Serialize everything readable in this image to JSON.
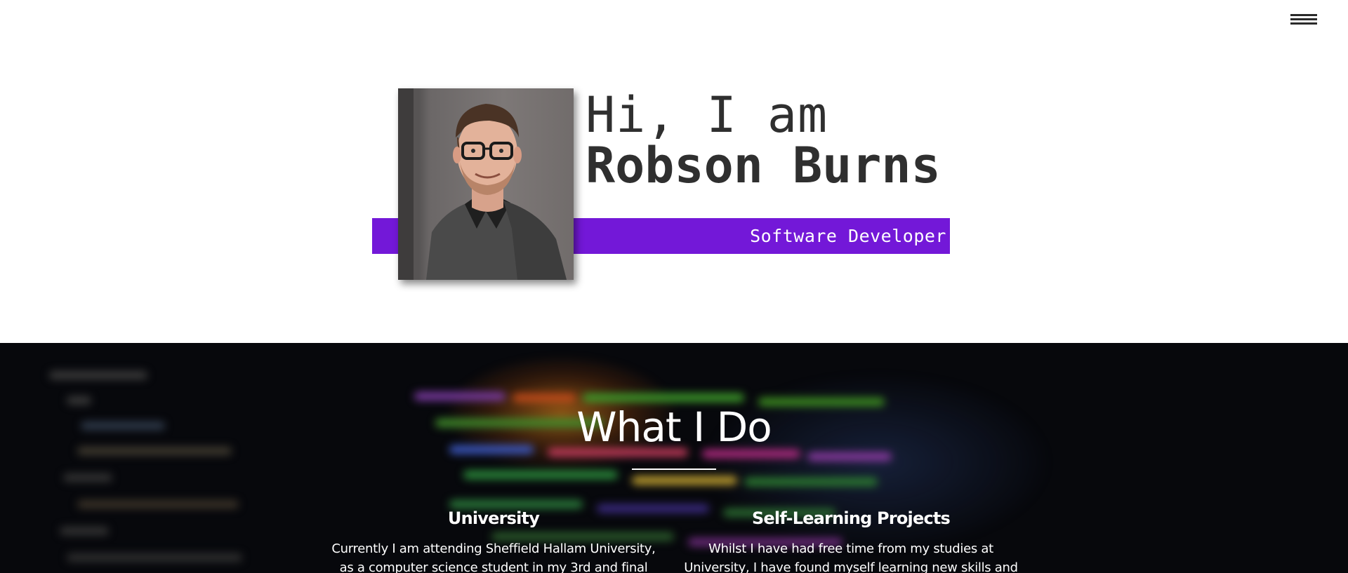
{
  "header": {
    "menu_icon": "hamburger-menu-icon"
  },
  "hero": {
    "greeting": "Hi, I am",
    "name": "Robson Burns",
    "role": "Software Developer",
    "portrait_alt": "Photo of Robson Burns",
    "accent_color": "#7318d8"
  },
  "what_i_do": {
    "title": "What I Do",
    "columns": [
      {
        "heading": "University",
        "text_line1": "Currently I am attending Sheffield Hallam University,",
        "text_line2": "as a computer science student in my 3rd and final"
      },
      {
        "heading": "Self-Learning Projects",
        "text_line1": "Whilst I have had free time from my studies at",
        "text_line2": "University, I have found myself learning new skills and"
      }
    ]
  }
}
